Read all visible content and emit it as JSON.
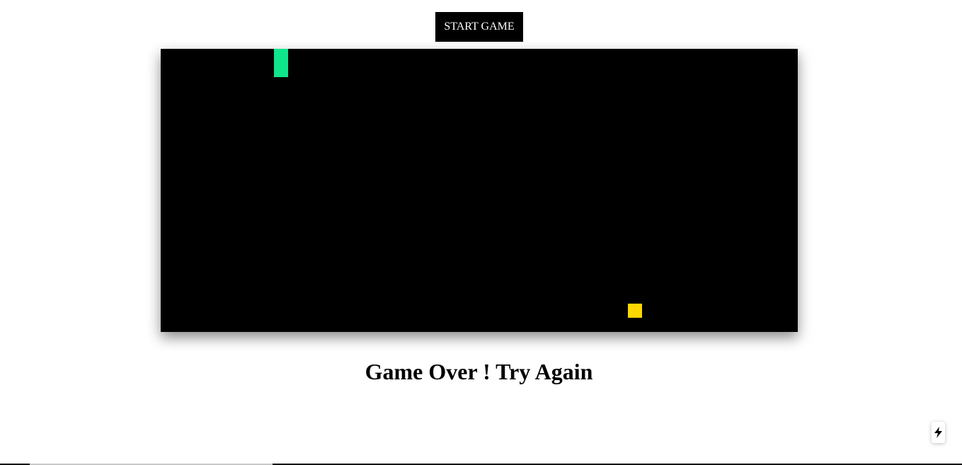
{
  "start_button": {
    "label": "START GAME"
  },
  "board": {
    "background": "#000000",
    "cols": 45,
    "rows": 20,
    "snake": {
      "color": "#0fe68c",
      "segments": [
        {
          "col": 8,
          "row": 0
        },
        {
          "col": 8,
          "row": 1
        }
      ]
    },
    "food": {
      "color": "#ffd700",
      "col": 33,
      "row": 18
    }
  },
  "status": {
    "message": "Game Over ! Try Again"
  },
  "dev_indicator": {
    "icon": "lightning-bolt-icon"
  }
}
